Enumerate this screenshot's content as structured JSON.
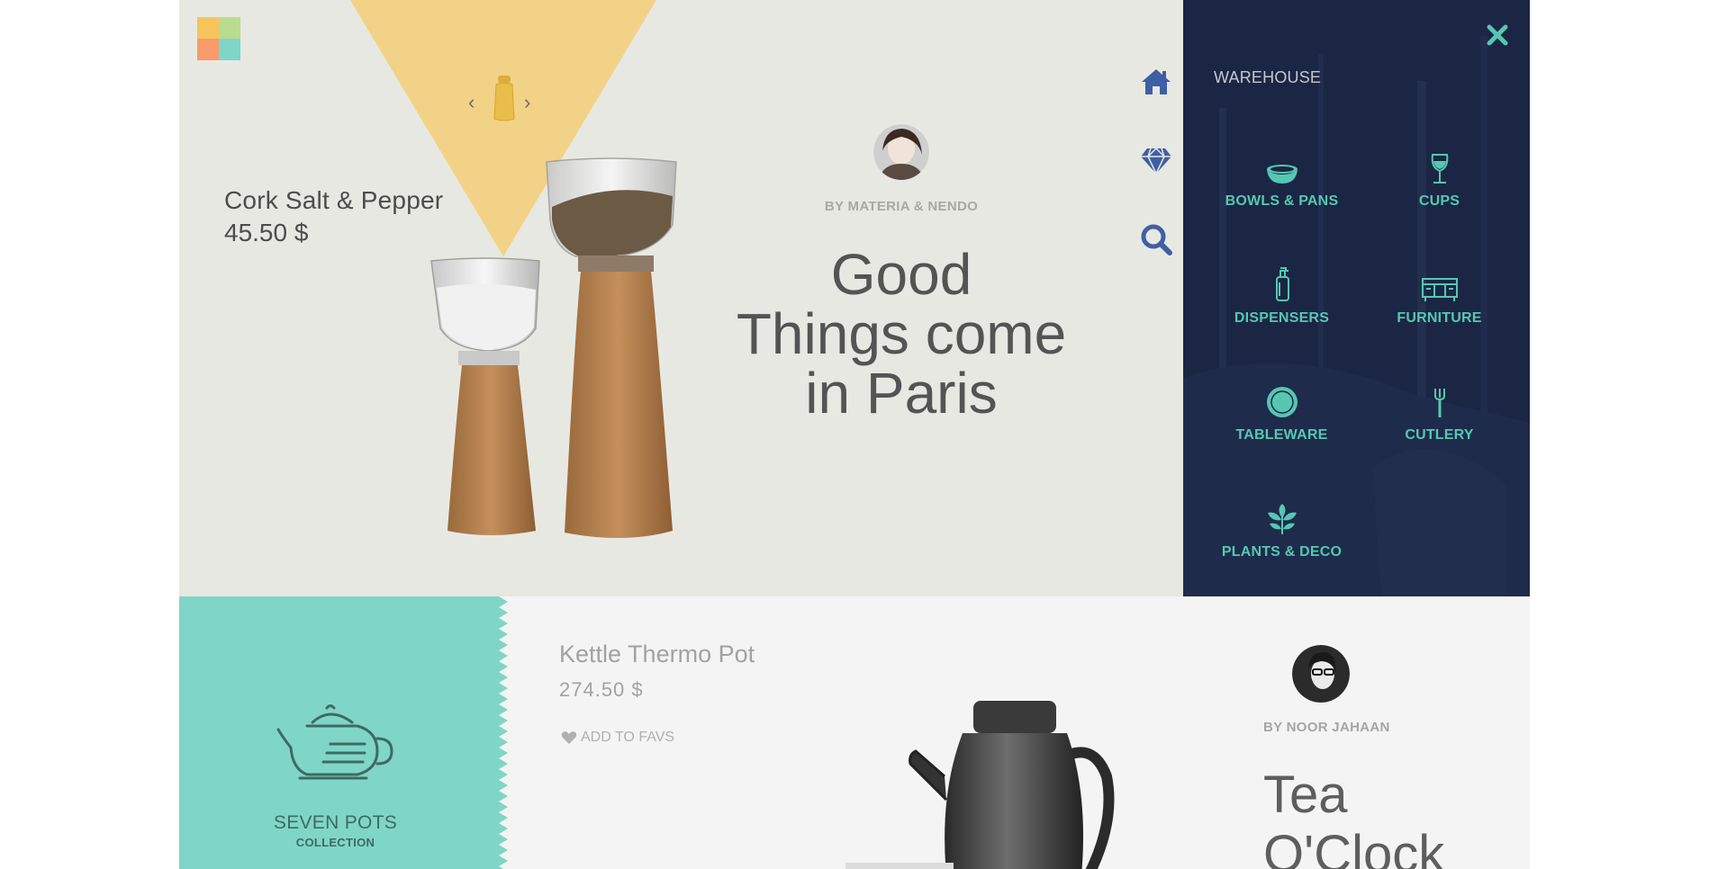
{
  "hero": {
    "product_name": "Cork Salt & Pepper",
    "product_price": "45.50 $",
    "author": "BY MATERIA & NENDO",
    "headline_lines": [
      "Good",
      "Things come",
      "in Paris"
    ]
  },
  "side_icons": [
    "home-icon",
    "diamond-icon",
    "search-icon"
  ],
  "menu": {
    "title": "WAREHOUSE",
    "items": [
      {
        "label": "BOWLS & PANS",
        "icon": "bowl-icon"
      },
      {
        "label": "CUPS",
        "icon": "wine-glass-icon"
      },
      {
        "label": "DISPENSERS",
        "icon": "dispenser-icon"
      },
      {
        "label": "FURNITURE",
        "icon": "furniture-icon"
      },
      {
        "label": "TABLEWARE",
        "icon": "plate-icon"
      },
      {
        "label": "CUTLERY",
        "icon": "fork-icon"
      },
      {
        "label": "PLANTS & DECO",
        "icon": "plant-icon"
      }
    ]
  },
  "collection": {
    "name": "SEVEN POTS",
    "sub": "COLLECTION"
  },
  "featured": {
    "product_name": "Kettle Thermo Pot",
    "product_price": "274.50 $",
    "fav_label": "ADD TO FAVS",
    "author": "BY NOOR JAHAAN",
    "headline_lines": [
      "Tea",
      "O'Clock"
    ]
  },
  "colors": {
    "accent_teal": "#56c7b2",
    "menu_bg": "#1b2644",
    "triangle_yellow": "#f2d286",
    "collection_bg": "#7fd6c6"
  }
}
